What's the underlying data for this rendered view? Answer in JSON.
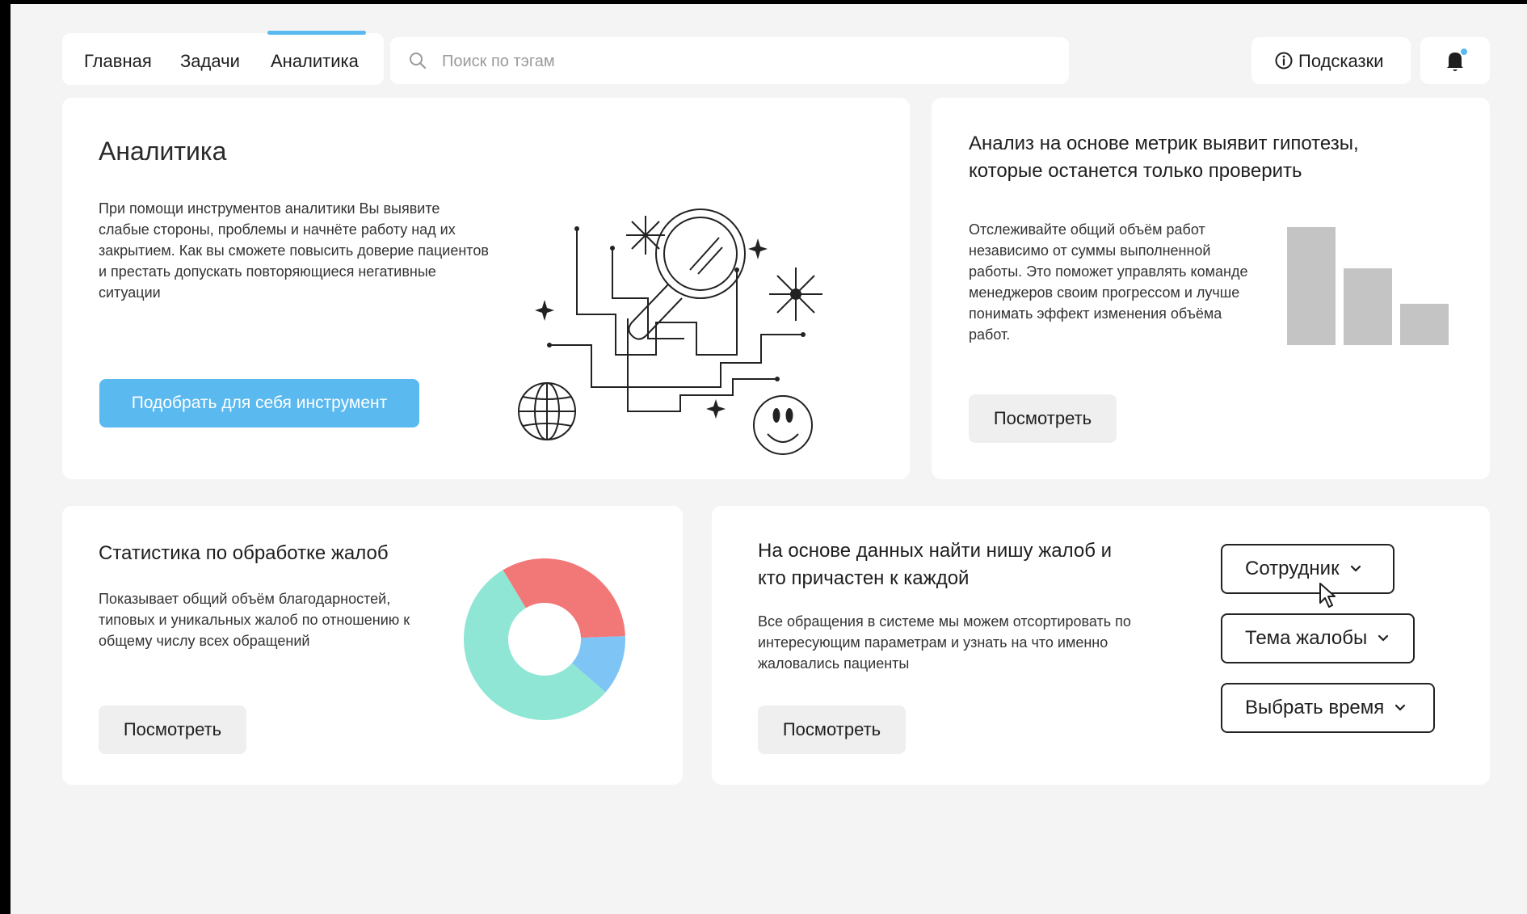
{
  "nav": {
    "items": [
      "Главная",
      "Задачи",
      "Аналитика"
    ],
    "active_index": 2
  },
  "search": {
    "placeholder": "Поиск по тэгам",
    "value": ""
  },
  "header": {
    "hints_label": "Подсказки",
    "notification_dot_color": "#5ab9ef"
  },
  "analytics_card": {
    "title": "Аналитика",
    "text": "При помощи инструментов аналитики Вы выявите слабые стороны, проблемы и начнёте работу над их закрытием. Как вы сможете повысить доверие пациентов и престать допускать повторяющиеся негативные ситуации",
    "button": "Подобрать для себя инструмент"
  },
  "metrics_card": {
    "title": "Анализ на основе метрик выявит гипотезы, которые останется только проверить",
    "text": "Отслеживайте общий объём работ независимо от суммы выполненной работы. Это поможет управлять команде менеджеров своим прогрессом и лучше понимать эффект изменения объёма работ.",
    "button": "Посмотреть"
  },
  "complaints_card": {
    "title": "Статистика  по обработке жалоб",
    "text": "Показывает общий объём благодарностей, типовых и уникальных жалоб по отношению к общему числу всех обращений",
    "button": "Посмотреть"
  },
  "niche_card": {
    "title": "На основе данных найти нишу жалоб и кто причастен к каждой",
    "text": "Все обращения в системе мы можем отсортировать по интересующим параметрам и узнать на что именно жаловались пациенты",
    "button": "Посмотреть",
    "filters": [
      "Сотрудник",
      "Тема жалобы",
      "Выбрать время"
    ]
  },
  "chart_data": [
    {
      "type": "bar",
      "categories": [
        "",
        "",
        ""
      ],
      "values": [
        100,
        65,
        35
      ],
      "ylim": [
        0,
        100
      ],
      "color": "#c4c4c4"
    },
    {
      "type": "pie",
      "donut": true,
      "slices": [
        {
          "value": 33,
          "color": "#f27878"
        },
        {
          "value": 12,
          "color": "#7ec4f5"
        },
        {
          "value": 55,
          "color": "#8fe6d4"
        }
      ]
    }
  ],
  "colors": {
    "accent": "#5ab9ef",
    "background": "#f4f4f4"
  }
}
